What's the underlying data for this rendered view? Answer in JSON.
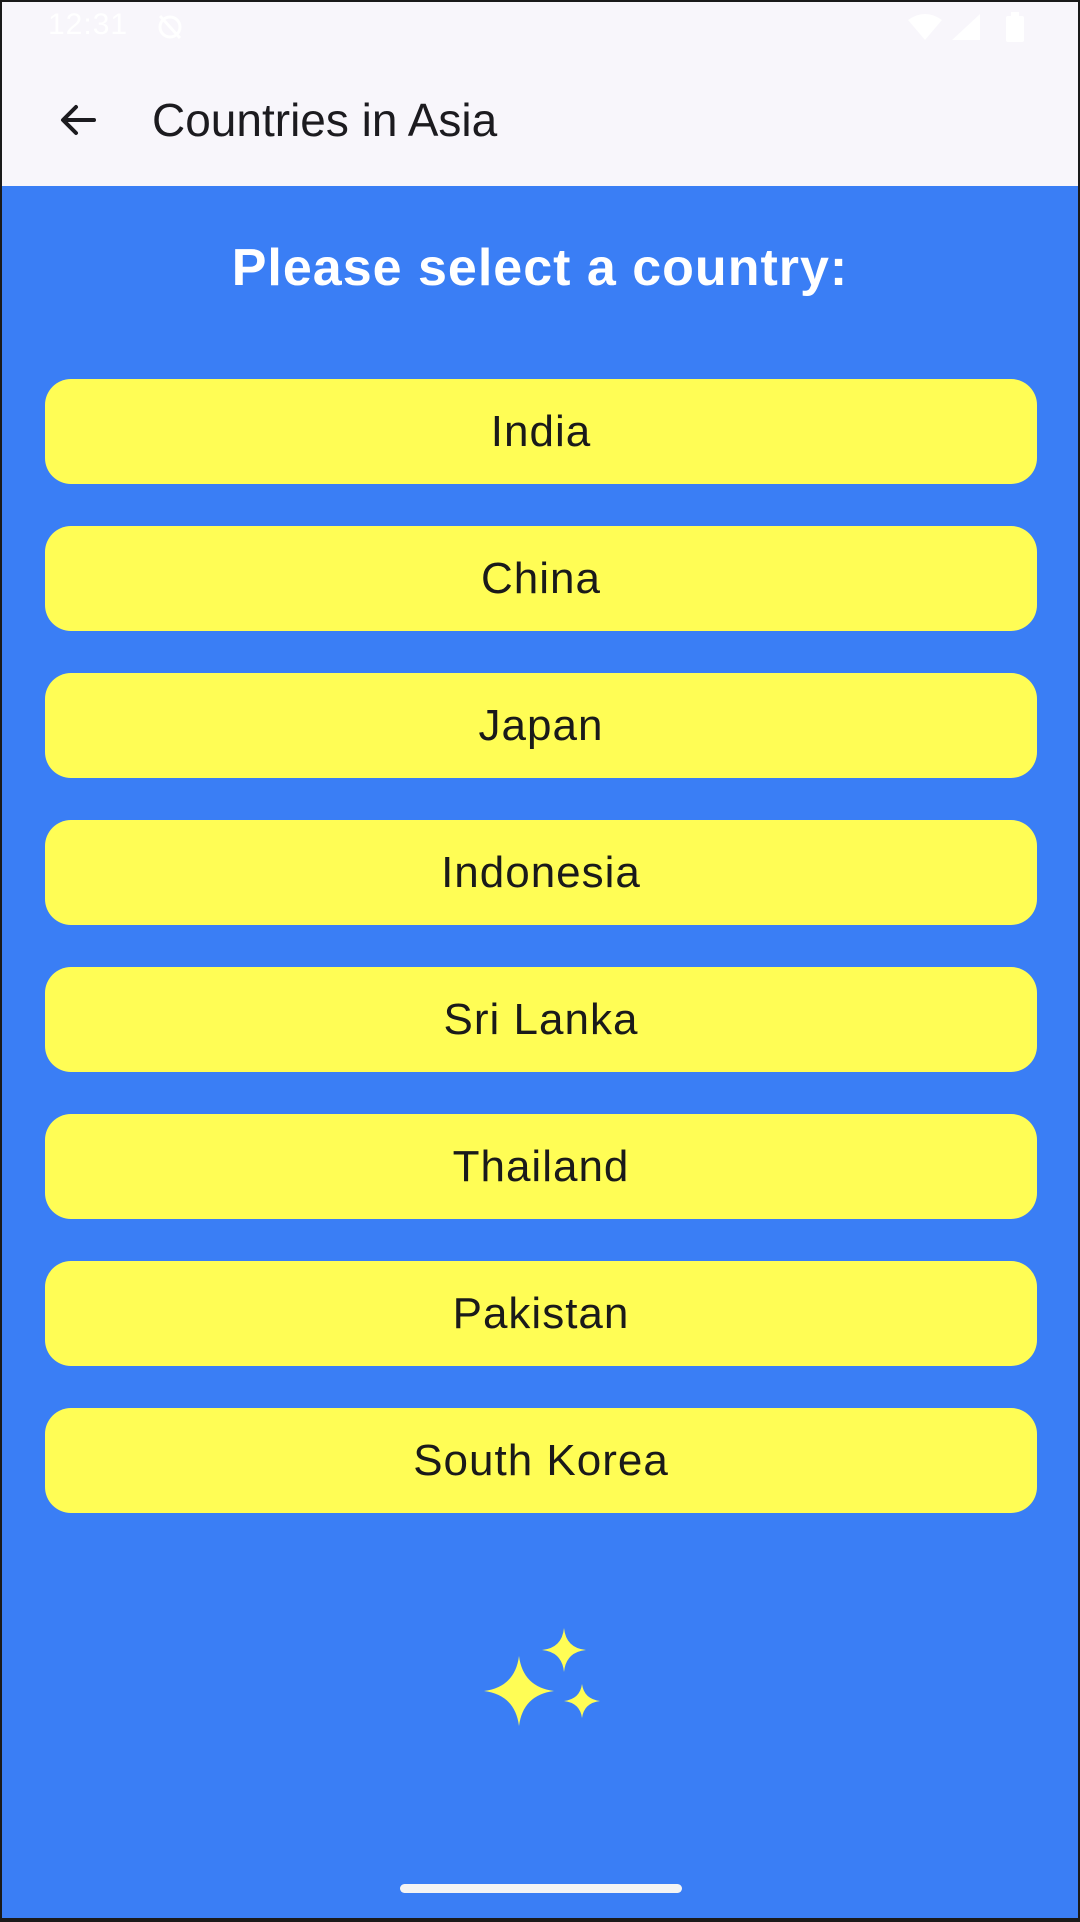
{
  "status_bar": {
    "time": "12:31",
    "alarm_icon": "alarm-off-icon",
    "wifi_icon": "wifi-icon",
    "signal_icon": "cell-signal-icon",
    "battery_icon": "battery-icon"
  },
  "app_bar": {
    "back_icon": "arrow-back-icon",
    "title": "Countries in Asia"
  },
  "main": {
    "prompt": "Please select a country:",
    "countries": [
      {
        "label": "India"
      },
      {
        "label": "China"
      },
      {
        "label": "Japan"
      },
      {
        "label": "Indonesia"
      },
      {
        "label": "Sri Lanka"
      },
      {
        "label": "Thailand"
      },
      {
        "label": "Pakistan"
      },
      {
        "label": "South Korea"
      }
    ],
    "decoration_icon": "sparkles-icon"
  },
  "colors": {
    "background": "#3a7ef5",
    "button": "#fffd55",
    "app_bar": "#f8f6fb",
    "prompt_text": "#ffffff",
    "button_text": "#1a1a1a"
  }
}
